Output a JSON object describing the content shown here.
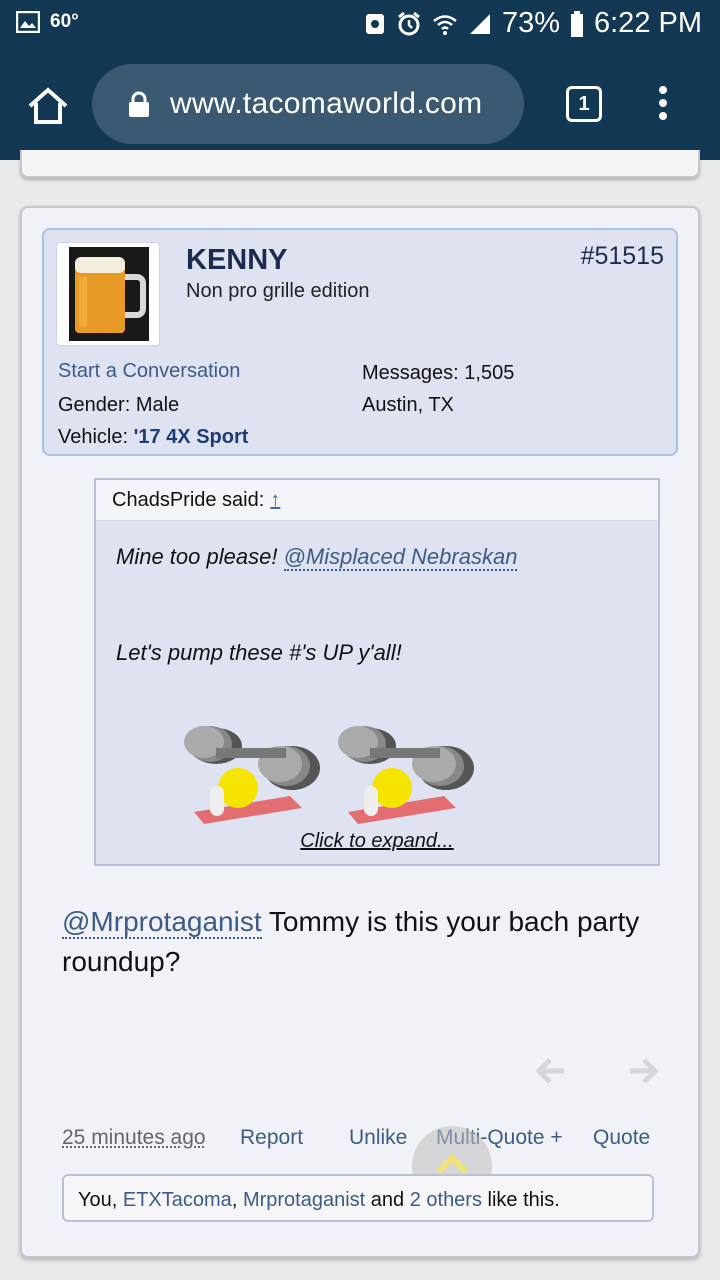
{
  "status_bar": {
    "temperature": "60°",
    "battery": "73%",
    "time": "6:22 PM"
  },
  "browser": {
    "url": "www.tacomaworld.com",
    "tab_count": "1"
  },
  "post": {
    "username": "KENNY",
    "user_title": "Non pro grille edition",
    "post_number": "#51515",
    "start_conversation": "Start a Conversation",
    "gender_label": "Gender:",
    "gender_value": "Male",
    "vehicle_label": "Vehicle:",
    "vehicle_value": "'17 4X Sport",
    "messages_label": "Messages:",
    "messages_value": "1,505",
    "location": "Austin, TX",
    "quote": {
      "author": "ChadsPride said:",
      "arrow": "↑",
      "line1_text": "Mine too please! ",
      "line1_mention": "@Misplaced Nebraskan",
      "line2": "Let's pump these #'s UP y'all!",
      "expand": "Click to expand..."
    },
    "message_mention": "@Mrprotaganist",
    "message_text": " Tommy is this your bach party roundup?",
    "actions": {
      "time": "25 minutes ago",
      "report": "Report",
      "unlike": "Unlike",
      "multiquote": "Multi-Quote +",
      "quote": "Quote"
    },
    "likes": {
      "you": "You, ",
      "user1": "ETXTacoma",
      "sep": ", ",
      "user2": "Mrprotaganist",
      "and": " and ",
      "others": "2 others",
      "suffix": " like this."
    }
  }
}
